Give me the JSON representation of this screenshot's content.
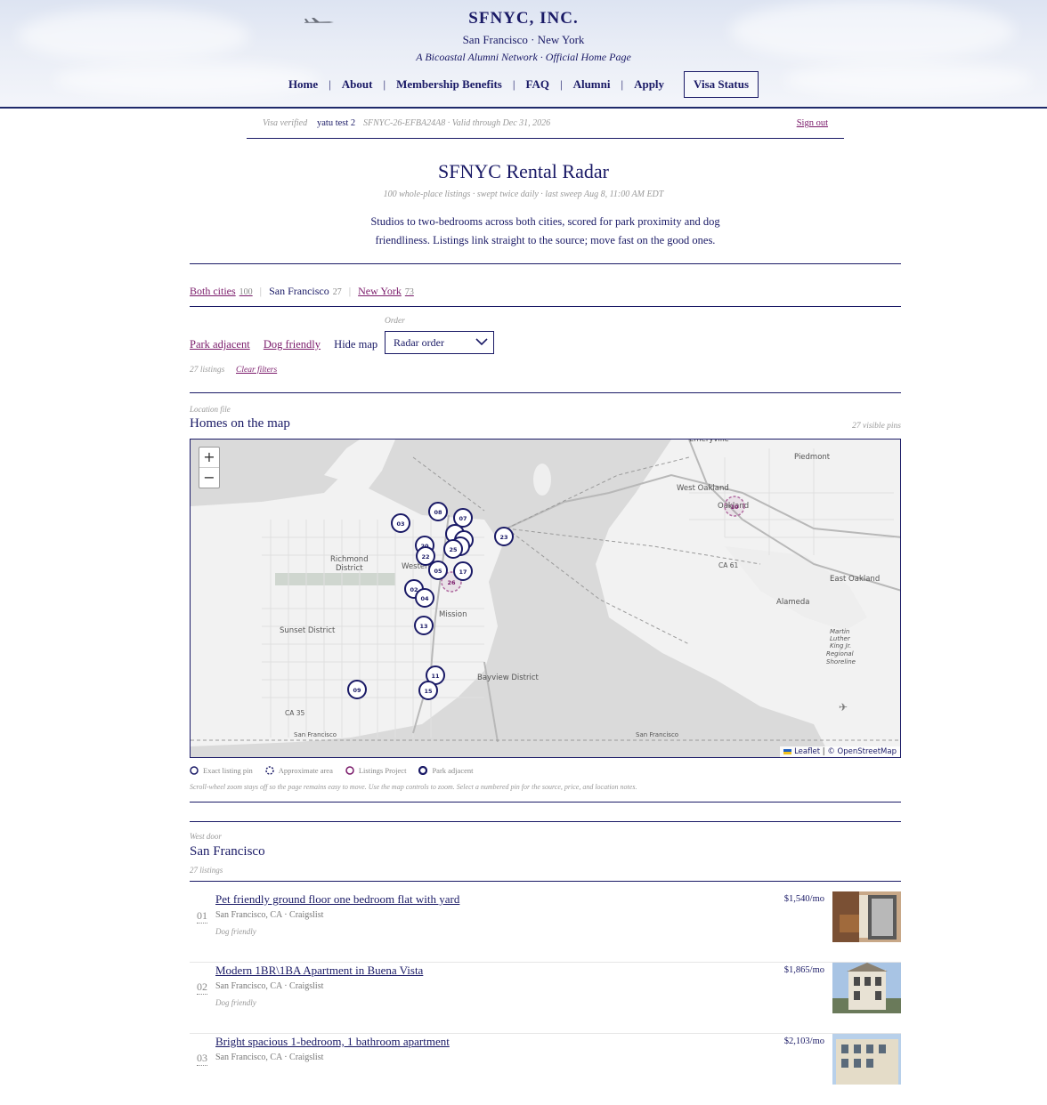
{
  "header": {
    "brand": "SFNYC, INC.",
    "cities": "San Francisco · New York",
    "tagline": "A Bicoastal Alumni Network · Official Home Page",
    "nav": [
      "Home",
      "About",
      "Membership Benefits",
      "FAQ",
      "Alumni",
      "Apply"
    ],
    "visa_button": "Visa Status"
  },
  "verification": {
    "label": "Visa verified",
    "user": "yatu test 2",
    "id_text": "SFNYC-26-EFBA24A8 · Valid through Dec 31, 2026",
    "sign_out": "Sign out"
  },
  "page": {
    "title": "SFNYC Rental Radar",
    "meta": "100 whole-place listings · swept twice daily · last sweep Aug 8, 11:00 AM EDT",
    "intro": "Studios to two-bedrooms across both cities, scored for park proximity and dog friendliness. Listings link straight to the source; move fast on the good ones."
  },
  "city_tabs": [
    {
      "label": "Both cities",
      "count": "100",
      "active": false
    },
    {
      "label": "San Francisco",
      "count": "27",
      "active": true
    },
    {
      "label": "New York",
      "count": "73",
      "active": false
    }
  ],
  "filters": {
    "park": "Park adjacent",
    "dog": "Dog friendly",
    "hide_map": "Hide map",
    "order_label": "Order",
    "order_value": "Radar order",
    "count": "27 listings",
    "clear": "Clear filters"
  },
  "map_section": {
    "kicker": "Location file",
    "heading": "Homes on the map",
    "visible_pins": "27 visible pins",
    "zoom_in": "+",
    "zoom_out": "−",
    "attribution_leaflet": "Leaflet",
    "attribution_sep": "|",
    "attribution_osm": "© OpenStreetMap",
    "legend": [
      "Exact listing pin",
      "Approximate area",
      "Listings Project",
      "Park adjacent"
    ],
    "note": "Scroll-wheel zoom stays off so the page remains easy to move. Use the map controls to zoom. Select a numbered pin for the source, price, and location notes.",
    "place_labels": [
      "Emeryville",
      "Piedmont",
      "West Oakland",
      "Oakland",
      "Richmond District",
      "Western",
      "Mission",
      "Sunset District",
      "Bayview District",
      "Alameda",
      "East Oakland",
      "Martin Luther King Jr. Regional Shoreline",
      "San Francisco",
      "San Francisco",
      "CA 35",
      "CA 61"
    ],
    "pins": [
      "08",
      "07",
      "03",
      "23",
      "20",
      "25",
      "22",
      "05",
      "17",
      "26",
      "02",
      "04",
      "13",
      "11",
      "15",
      "09",
      "10"
    ]
  },
  "sf_section": {
    "kicker": "West door",
    "heading": "San Francisco",
    "count": "27 listings"
  },
  "listings": [
    {
      "num": "01",
      "title": "Pet friendly ground floor one bedroom flat with yard",
      "location": "San Francisco, CA · Craigslist",
      "tag": "Dog friendly",
      "price": "$1,540/mo"
    },
    {
      "num": "02",
      "title": "Modern 1BR\\1BA Apartment in Buena Vista",
      "location": "San Francisco, CA · Craigslist",
      "tag": "Dog friendly",
      "price": "$1,865/mo"
    },
    {
      "num": "03",
      "title": "Bright spacious 1-bedroom, 1 bathroom apartment",
      "location": "San Francisco, CA · Craigslist",
      "tag": "",
      "price": "$2,103/mo"
    }
  ],
  "colors": {
    "navy": "#1a1a66",
    "plum": "#7a1a6a",
    "muted": "#999999"
  }
}
